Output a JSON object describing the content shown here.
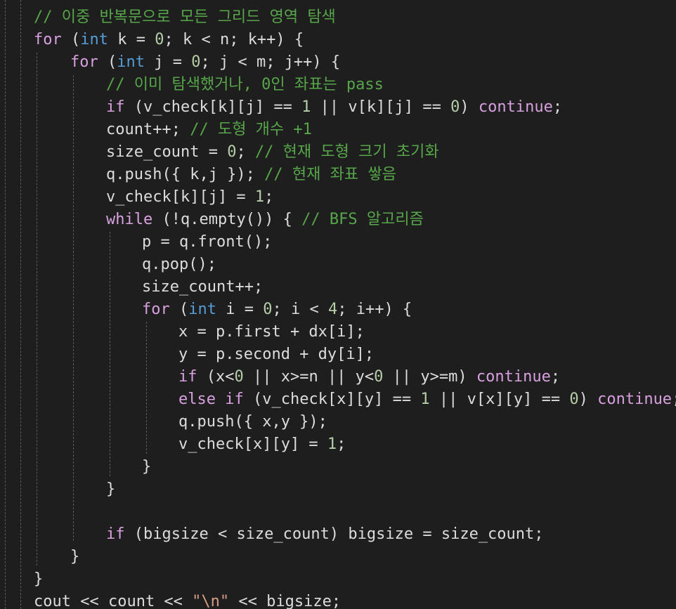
{
  "editor": {
    "colors": {
      "background": "#1e1e1e",
      "default": "#dcdcdc",
      "keyword": "#569cd6",
      "control": "#d8a0df",
      "comment": "#57a64a",
      "number": "#b5cea8",
      "string": "#d69d85",
      "guide": "#5a5a5a"
    },
    "lines": [
      [
        {
          "t": "// 이중 반복문으로 모든 그리드 영역 탐색",
          "c": "cm"
        }
      ],
      [
        {
          "t": "for",
          "c": "ctl"
        },
        {
          "t": " (",
          "c": ""
        },
        {
          "t": "int",
          "c": "kw"
        },
        {
          "t": " k = ",
          "c": ""
        },
        {
          "t": "0",
          "c": "num"
        },
        {
          "t": "; k < n; k++) {",
          "c": ""
        }
      ],
      [
        {
          "t": "for",
          "c": "ctl"
        },
        {
          "t": " (",
          "c": ""
        },
        {
          "t": "int",
          "c": "kw"
        },
        {
          "t": " j = ",
          "c": ""
        },
        {
          "t": "0",
          "c": "num"
        },
        {
          "t": "; j < m; j++) {",
          "c": ""
        }
      ],
      [
        {
          "t": "// 이미 탐색했거나, 0인 좌표는 pass",
          "c": "cm"
        }
      ],
      [
        {
          "t": "if",
          "c": "ctl"
        },
        {
          "t": " (v_check[k][j] == ",
          "c": ""
        },
        {
          "t": "1",
          "c": "num"
        },
        {
          "t": " || v[k][j] == ",
          "c": ""
        },
        {
          "t": "0",
          "c": "num"
        },
        {
          "t": ") ",
          "c": ""
        },
        {
          "t": "continue",
          "c": "ctl"
        },
        {
          "t": ";",
          "c": ""
        }
      ],
      [
        {
          "t": "count++; ",
          "c": ""
        },
        {
          "t": "// 도형 개수 +1",
          "c": "cm"
        }
      ],
      [
        {
          "t": "size_count = ",
          "c": ""
        },
        {
          "t": "0",
          "c": "num"
        },
        {
          "t": "; ",
          "c": ""
        },
        {
          "t": "// 현재 도형 크기 초기화",
          "c": "cm"
        }
      ],
      [
        {
          "t": "q.push({ k,j }); ",
          "c": ""
        },
        {
          "t": "// 현재 좌표 쌓음",
          "c": "cm"
        }
      ],
      [
        {
          "t": "v_check[k][j] = ",
          "c": ""
        },
        {
          "t": "1",
          "c": "num"
        },
        {
          "t": ";",
          "c": ""
        }
      ],
      [
        {
          "t": "while",
          "c": "ctl"
        },
        {
          "t": " (!q.empty()) { ",
          "c": ""
        },
        {
          "t": "// BFS 알고리즘",
          "c": "cm"
        }
      ],
      [
        {
          "t": "p = q.front();",
          "c": ""
        }
      ],
      [
        {
          "t": "q.pop();",
          "c": ""
        }
      ],
      [
        {
          "t": "size_count++;",
          "c": ""
        }
      ],
      [
        {
          "t": "for",
          "c": "ctl"
        },
        {
          "t": " (",
          "c": ""
        },
        {
          "t": "int",
          "c": "kw"
        },
        {
          "t": " i = ",
          "c": ""
        },
        {
          "t": "0",
          "c": "num"
        },
        {
          "t": "; i < ",
          "c": ""
        },
        {
          "t": "4",
          "c": "num"
        },
        {
          "t": "; i++) {",
          "c": ""
        }
      ],
      [
        {
          "t": "x = p.first + dx[i];",
          "c": ""
        }
      ],
      [
        {
          "t": "y = p.second + dy[i];",
          "c": ""
        }
      ],
      [
        {
          "t": "if",
          "c": "ctl"
        },
        {
          "t": " (x<",
          "c": ""
        },
        {
          "t": "0",
          "c": "num"
        },
        {
          "t": " || x>=n || y<",
          "c": ""
        },
        {
          "t": "0",
          "c": "num"
        },
        {
          "t": " || y>=m) ",
          "c": ""
        },
        {
          "t": "continue",
          "c": "ctl"
        },
        {
          "t": ";",
          "c": ""
        }
      ],
      [
        {
          "t": "else",
          "c": "ctl"
        },
        {
          "t": " ",
          "c": ""
        },
        {
          "t": "if",
          "c": "ctl"
        },
        {
          "t": " (v_check[x][y] == ",
          "c": ""
        },
        {
          "t": "1",
          "c": "num"
        },
        {
          "t": " || v[x][y] == ",
          "c": ""
        },
        {
          "t": "0",
          "c": "num"
        },
        {
          "t": ") ",
          "c": ""
        },
        {
          "t": "continue",
          "c": "ctl"
        },
        {
          "t": ";",
          "c": ""
        }
      ],
      [
        {
          "t": "q.push({ x,y });",
          "c": ""
        }
      ],
      [
        {
          "t": "v_check[x][y] = ",
          "c": ""
        },
        {
          "t": "1",
          "c": "num"
        },
        {
          "t": ";",
          "c": ""
        }
      ],
      [
        {
          "t": "}",
          "c": ""
        }
      ],
      [
        {
          "t": "}",
          "c": ""
        }
      ],
      [],
      [
        {
          "t": "if",
          "c": "ctl"
        },
        {
          "t": " (bigsize < size_count) bigsize = size_count;",
          "c": ""
        }
      ],
      [
        {
          "t": "}",
          "c": ""
        }
      ],
      [
        {
          "t": "}",
          "c": ""
        }
      ],
      [
        {
          "t": "cout << count << ",
          "c": ""
        },
        {
          "t": "\"\\n\"",
          "c": "str"
        },
        {
          "t": " << bigsize;",
          "c": ""
        }
      ]
    ]
  }
}
